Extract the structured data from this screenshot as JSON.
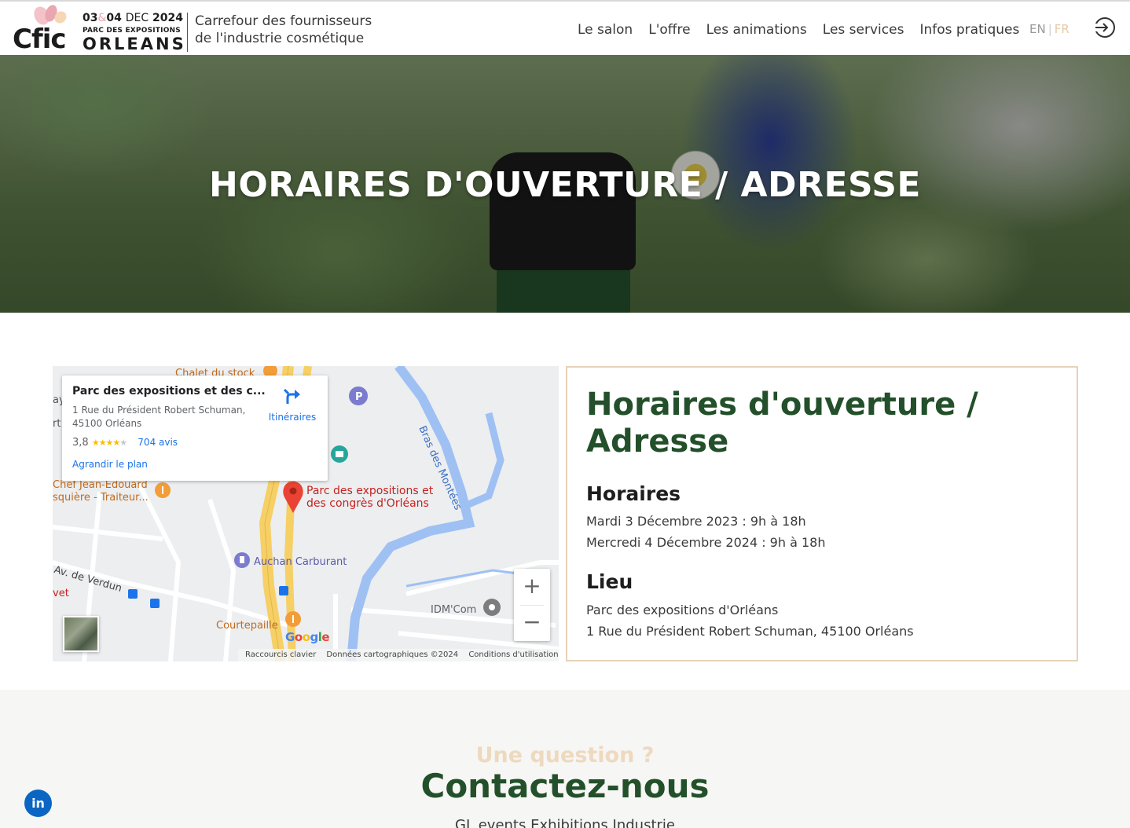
{
  "header": {
    "logo": {
      "brand": "Cfic",
      "date_days_a": "03",
      "date_amp": "&",
      "date_days_b": "04",
      "date_month": "DEC",
      "date_year": "2024",
      "venue": "PARC DES EXPOSITIONS",
      "city": "ORLEANS"
    },
    "tagline_line1": "Carrefour des fournisseurs",
    "tagline_line2": "de l'industrie cosmétique",
    "nav": [
      "Le salon",
      "L'offre",
      "Les animations",
      "Les services",
      "Infos pratiques"
    ],
    "lang_en": "EN",
    "lang_sep": "|",
    "lang_fr": "FR"
  },
  "hero": {
    "title": "HORAIRES D'OUVERTURE / ADRESSE"
  },
  "map": {
    "card": {
      "title": "Parc des expositions et des c...",
      "address_line1": "1 Rue du Président Robert Schuman,",
      "address_line2": "45100 Orléans",
      "rating": "3,8",
      "reviews": "704 avis",
      "directions": "Itinéraires",
      "enlarge": "Agrandir le plan"
    },
    "pin_label_line1": "Parc des expositions et",
    "pin_label_line2": "des congrès d'Orléans",
    "labels": {
      "chalet": "Chalet du stock",
      "chef_line1": "Chef Jean-Edouard",
      "chef_line2": "squière -  Traiteur...",
      "river": "Bras des Montées",
      "auchan": "Auchan Carburant",
      "verdun": "Av. de Verdun",
      "vet": "vet",
      "courtepaille": "Courtepaille",
      "idm": "IDM'Com",
      "ay": "ay",
      "rt": "rt"
    },
    "zoom_in": "+",
    "zoom_out": "−",
    "google": "Google",
    "footer": [
      "Raccourcis clavier",
      "Données cartographiques ©2024",
      "Conditions d'utilisation"
    ]
  },
  "info": {
    "title": "Horaires d'ouverture / Adresse",
    "hours_heading": "Horaires",
    "hours": [
      "Mardi 3 Décembre 2023 : 9h à 18h",
      "Mercredi 4 Décembre 2024 : 9h à 18h"
    ],
    "place_heading": "Lieu",
    "place": [
      "Parc des expositions d'Orléans",
      "1 Rue du Président Robert Schuman, 45100 Orléans"
    ]
  },
  "contact": {
    "kicker": "Une question ?",
    "title": "Contactez-nous",
    "org": "GL events Exhibitions Industrie"
  },
  "social": {
    "linkedin": "in"
  },
  "colors": {
    "brand_green": "#23502a",
    "accent_beige": "#e7d2b8",
    "link_blue": "#1a73e8",
    "linkedin_blue": "#0a66c2"
  }
}
